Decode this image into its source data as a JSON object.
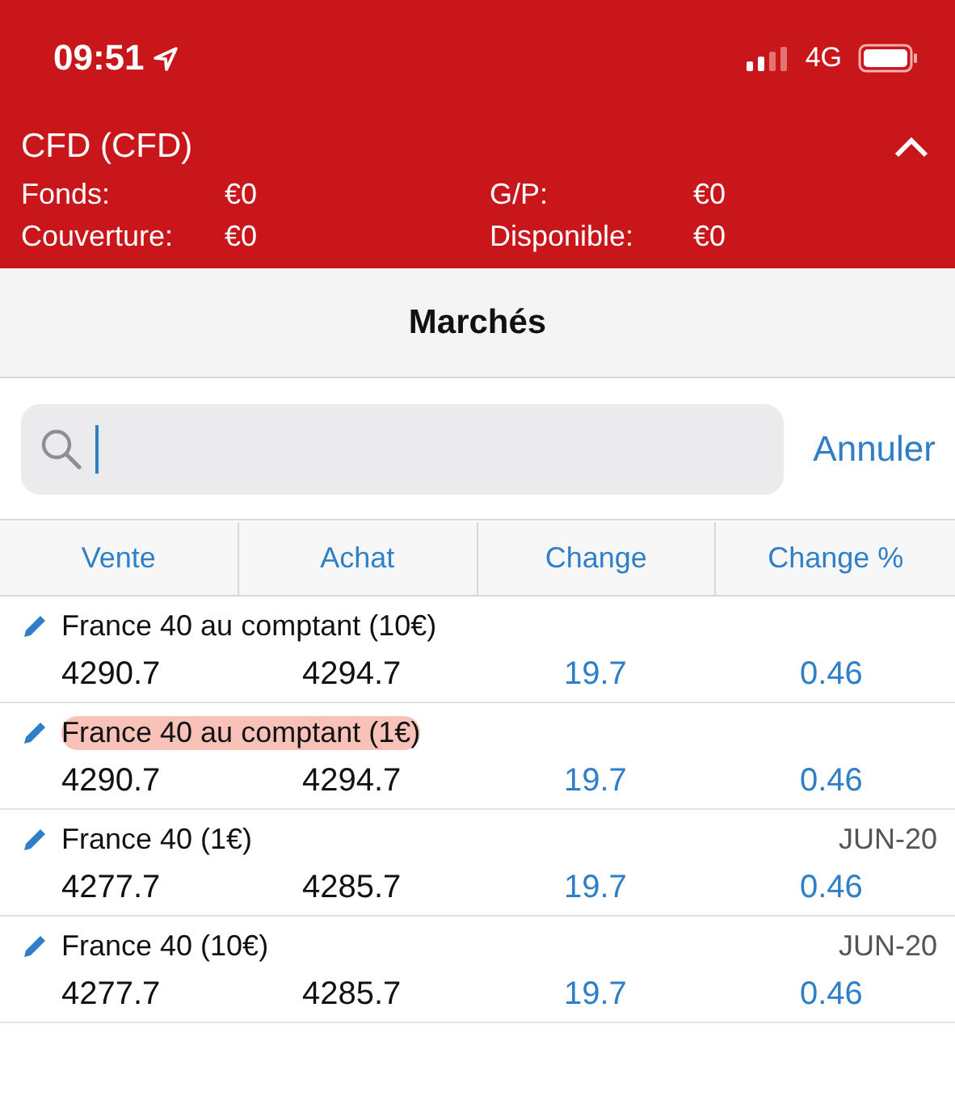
{
  "status_bar": {
    "time": "09:51",
    "network": "4G"
  },
  "account": {
    "title": "CFD (CFD)",
    "expanded": true,
    "fields": [
      {
        "label": "Fonds:",
        "value": "€0"
      },
      {
        "label": "G/P:",
        "value": "€0"
      },
      {
        "label": "Couverture:",
        "value": "€0"
      },
      {
        "label": "Disponible:",
        "value": "€0"
      }
    ]
  },
  "nav": {
    "title": "Marchés"
  },
  "search": {
    "cancel": "Annuler"
  },
  "table": {
    "columns": [
      "Vente",
      "Achat",
      "Change",
      "Change %"
    ],
    "rows": [
      {
        "name": "France 40 au comptant (10€)",
        "sell": "4290.7",
        "buy": "4294.7",
        "change": "19.7",
        "change_pct": "0.46",
        "highlighted": false
      },
      {
        "name": "France 40 au comptant (1€)",
        "sell": "4290.7",
        "buy": "4294.7",
        "change": "19.7",
        "change_pct": "0.46",
        "highlighted": true
      },
      {
        "name": "France 40 (1€)",
        "expiry": "JUN-20",
        "sell": "4277.7",
        "buy": "4285.7",
        "change": "19.7",
        "change_pct": "0.46",
        "highlighted": false
      },
      {
        "name": "France 40 (10€)",
        "expiry": "JUN-20",
        "sell": "4277.7",
        "buy": "4285.7",
        "change": "19.7",
        "change_pct": "0.46",
        "highlighted": false
      }
    ]
  }
}
